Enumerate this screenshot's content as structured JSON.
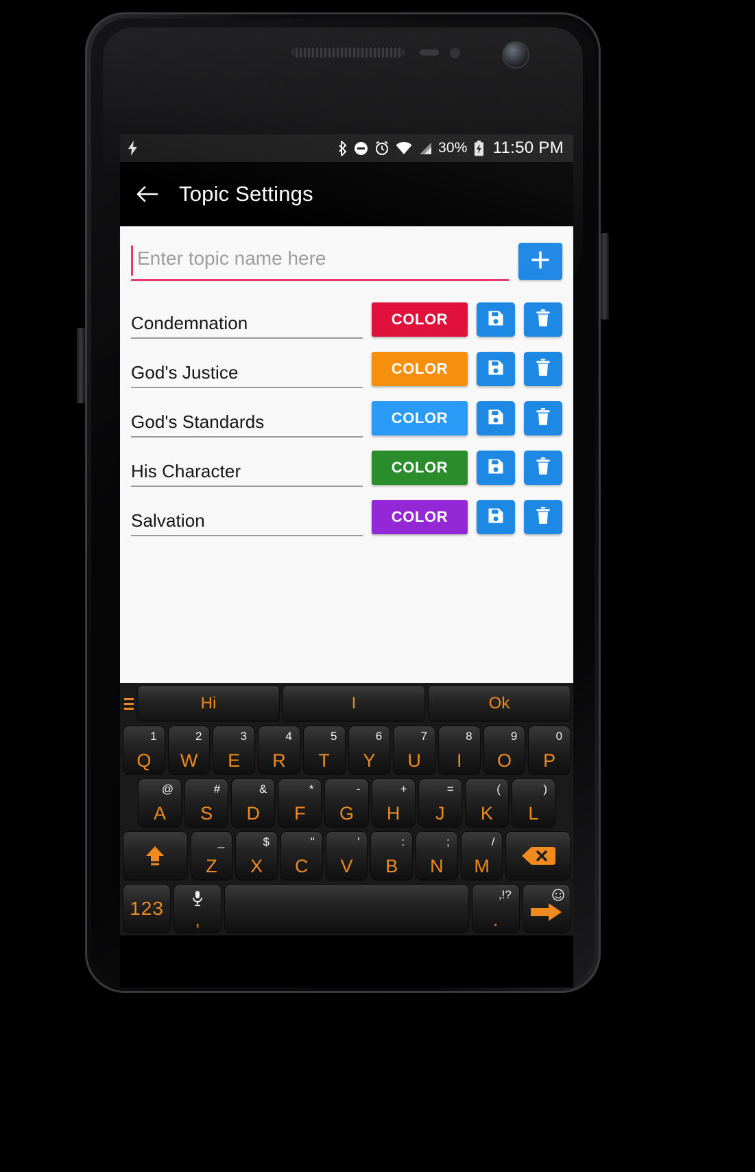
{
  "statusbar": {
    "charging_icon": "bolt-icon",
    "icons": [
      "bluetooth-icon",
      "do-not-disturb-icon",
      "alarm-icon",
      "wifi-icon",
      "cellular-signal-icon"
    ],
    "battery_percent": "30%",
    "battery_icon": "battery-charging-icon",
    "time": "11:50 PM"
  },
  "appbar": {
    "back_icon": "back-arrow-icon",
    "title": "Topic Settings"
  },
  "new_topic": {
    "placeholder": "Enter topic name here",
    "value": "",
    "add_label": "+",
    "add_icon": "plus-icon",
    "accent_color": "#e8376f"
  },
  "topics": [
    {
      "name": "Condemnation",
      "color_label": "COLOR",
      "color": "#e0123c",
      "save_icon": "floppy-save-icon",
      "delete_icon": "trash-delete-icon"
    },
    {
      "name": "God's Justice",
      "color_label": "COLOR",
      "color": "#f78f0e",
      "save_icon": "floppy-save-icon",
      "delete_icon": "trash-delete-icon"
    },
    {
      "name": "God's Standards",
      "color_label": "COLOR",
      "color": "#2a9bf7",
      "save_icon": "floppy-save-icon",
      "delete_icon": "trash-delete-icon"
    },
    {
      "name": "His Character",
      "color_label": "COLOR",
      "color": "#2b8c2b",
      "save_icon": "floppy-save-icon",
      "delete_icon": "trash-delete-icon"
    },
    {
      "name": "Salvation",
      "color_label": "COLOR",
      "color": "#9427d6",
      "save_icon": "floppy-save-icon",
      "delete_icon": "trash-delete-icon"
    }
  ],
  "button_colors": {
    "icon_button_bg": "#1e88e5"
  },
  "keyboard": {
    "menu_icon": "hamburger-menu-icon",
    "suggestions": [
      "Hi",
      "I",
      "Ok"
    ],
    "row1": [
      {
        "letter": "Q",
        "alt": "1"
      },
      {
        "letter": "W",
        "alt": "2"
      },
      {
        "letter": "E",
        "alt": "3"
      },
      {
        "letter": "R",
        "alt": "4"
      },
      {
        "letter": "T",
        "alt": "5"
      },
      {
        "letter": "Y",
        "alt": "6"
      },
      {
        "letter": "U",
        "alt": "7"
      },
      {
        "letter": "I",
        "alt": "8"
      },
      {
        "letter": "O",
        "alt": "9"
      },
      {
        "letter": "P",
        "alt": "0"
      }
    ],
    "row2": [
      {
        "letter": "A",
        "alt": "@"
      },
      {
        "letter": "S",
        "alt": "#"
      },
      {
        "letter": "D",
        "alt": "&"
      },
      {
        "letter": "F",
        "alt": "*"
      },
      {
        "letter": "G",
        "alt": "-"
      },
      {
        "letter": "H",
        "alt": "+"
      },
      {
        "letter": "J",
        "alt": "="
      },
      {
        "letter": "K",
        "alt": "("
      },
      {
        "letter": "L",
        "alt": ")"
      }
    ],
    "row3": [
      {
        "letter": "Z",
        "alt": "_"
      },
      {
        "letter": "X",
        "alt": "$"
      },
      {
        "letter": "C",
        "alt": "\""
      },
      {
        "letter": "V",
        "alt": "'"
      },
      {
        "letter": "B",
        "alt": ":"
      },
      {
        "letter": "N",
        "alt": ";"
      },
      {
        "letter": "M",
        "alt": "/"
      }
    ],
    "shift_icon": "shift-up-arrow-icon",
    "backspace_icon": "backspace-icon",
    "numbers_label": "123",
    "comma_label": ",",
    "mic_icon": "microphone-icon",
    "space_label": "",
    "period_label": ".",
    "period_alt": ",!?",
    "enter_icon": "enter-arrow-icon",
    "emoji_icon": "smiley-emoji-icon",
    "accent_color": "#f08a1e"
  }
}
